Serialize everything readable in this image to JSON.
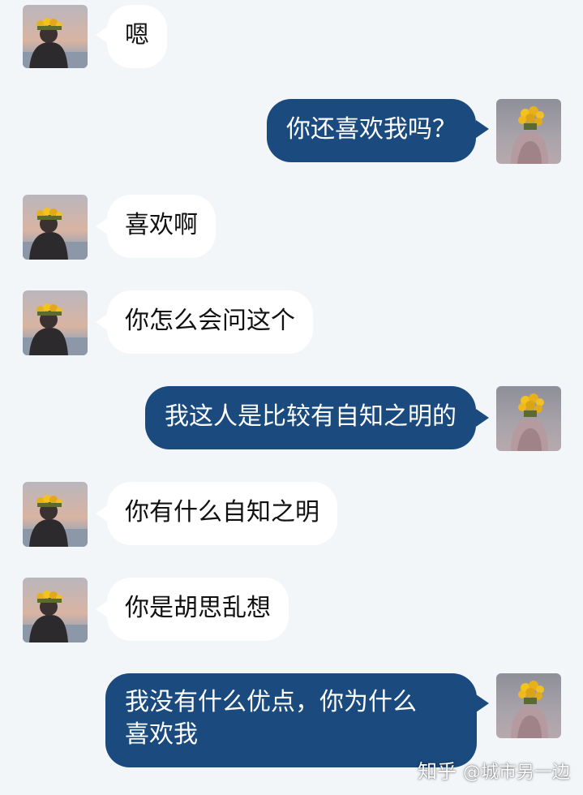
{
  "messages": [
    {
      "side": "in",
      "text": "嗯"
    },
    {
      "side": "out",
      "text": "你还喜欢我吗？"
    },
    {
      "side": "in",
      "text": "喜欢啊"
    },
    {
      "side": "in",
      "text": "你怎么会问这个"
    },
    {
      "side": "out",
      "text": "我这人是比较有自知之明的"
    },
    {
      "side": "in",
      "text": "你有什么自知之明"
    },
    {
      "side": "in",
      "text": "你是胡思乱想"
    },
    {
      "side": "out",
      "line1": "我没有什么优点，你为什么",
      "line2": "喜欢我"
    }
  ],
  "watermark": {
    "logo": "知乎",
    "handle": "@城市另一边"
  },
  "colors": {
    "background": "#f3f6f9",
    "incoming_bubble": "#ffffff",
    "outgoing_bubble": "#1a4a7e"
  }
}
